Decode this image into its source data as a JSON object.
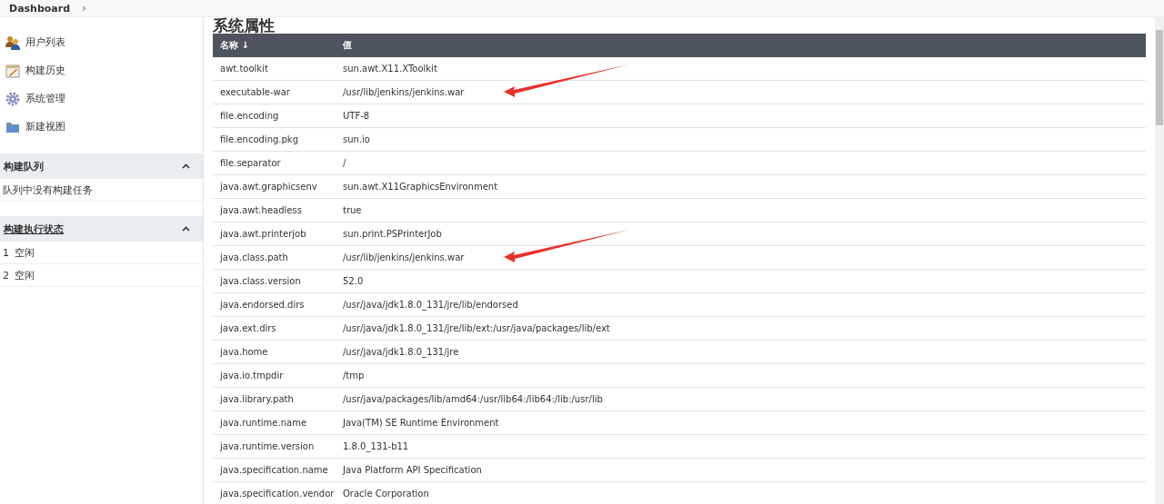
{
  "breadcrumb": {
    "label": "Dashboard"
  },
  "sidebar": {
    "items": [
      {
        "label": "用户列表",
        "kind": "users"
      },
      {
        "label": "构建历史",
        "kind": "notepad"
      },
      {
        "label": "系统管理",
        "kind": "gear"
      },
      {
        "label": "新建视图",
        "kind": "folder"
      }
    ],
    "queue": {
      "title": "构建队列",
      "expanded": true,
      "message": "队列中没有构建任务"
    },
    "executors": {
      "title": "构建执行状态",
      "expanded": true,
      "rows": [
        {
          "number": "1",
          "status": "空闲"
        },
        {
          "number": "2",
          "status": "空闲"
        }
      ]
    }
  },
  "page_title": "系统属性",
  "table": {
    "columns": [
      {
        "label": "名称",
        "sort": "↓"
      },
      {
        "label": "值"
      }
    ],
    "rows": [
      {
        "name": "awt.toolkit",
        "value": "sun.awt.X11.XToolkit",
        "arrow": false
      },
      {
        "name": "executable-war",
        "value": "/usr/lib/jenkins/jenkins.war",
        "arrow": true
      },
      {
        "name": "file.encoding",
        "value": "UTF-8",
        "arrow": false
      },
      {
        "name": "file.encoding.pkg",
        "value": "sun.io",
        "arrow": false
      },
      {
        "name": "file.separator",
        "value": "/",
        "arrow": false
      },
      {
        "name": "java.awt.graphicsenv",
        "value": "sun.awt.X11GraphicsEnvironment",
        "arrow": false
      },
      {
        "name": "java.awt.headless",
        "value": "true",
        "arrow": false
      },
      {
        "name": "java.awt.printerjob",
        "value": "sun.print.PSPrinterJob",
        "arrow": false
      },
      {
        "name": "java.class.path",
        "value": "/usr/lib/jenkins/jenkins.war",
        "arrow": true
      },
      {
        "name": "java.class.version",
        "value": "52.0",
        "arrow": false
      },
      {
        "name": "java.endorsed.dirs",
        "value": "/usr/java/jdk1.8.0_131/jre/lib/endorsed",
        "arrow": false
      },
      {
        "name": "java.ext.dirs",
        "value": "/usr/java/jdk1.8.0_131/jre/lib/ext:/usr/java/packages/lib/ext",
        "arrow": false
      },
      {
        "name": "java.home",
        "value": "/usr/java/jdk1.8.0_131/jre",
        "arrow": false
      },
      {
        "name": "java.io.tmpdir",
        "value": "/tmp",
        "arrow": false
      },
      {
        "name": "java.library.path",
        "value": "/usr/java/packages/lib/amd64:/usr/lib64:/lib64:/lib:/usr/lib",
        "arrow": false
      },
      {
        "name": "java.runtime.name",
        "value": "Java(TM) SE Runtime Environment",
        "arrow": false
      },
      {
        "name": "java.runtime.version",
        "value": "1.8.0_131-b11",
        "arrow": false
      },
      {
        "name": "java.specification.name",
        "value": "Java Platform API Specification",
        "arrow": false
      },
      {
        "name": "java.specification.vendor",
        "value": "Oracle Corporation",
        "arrow": false
      }
    ]
  }
}
